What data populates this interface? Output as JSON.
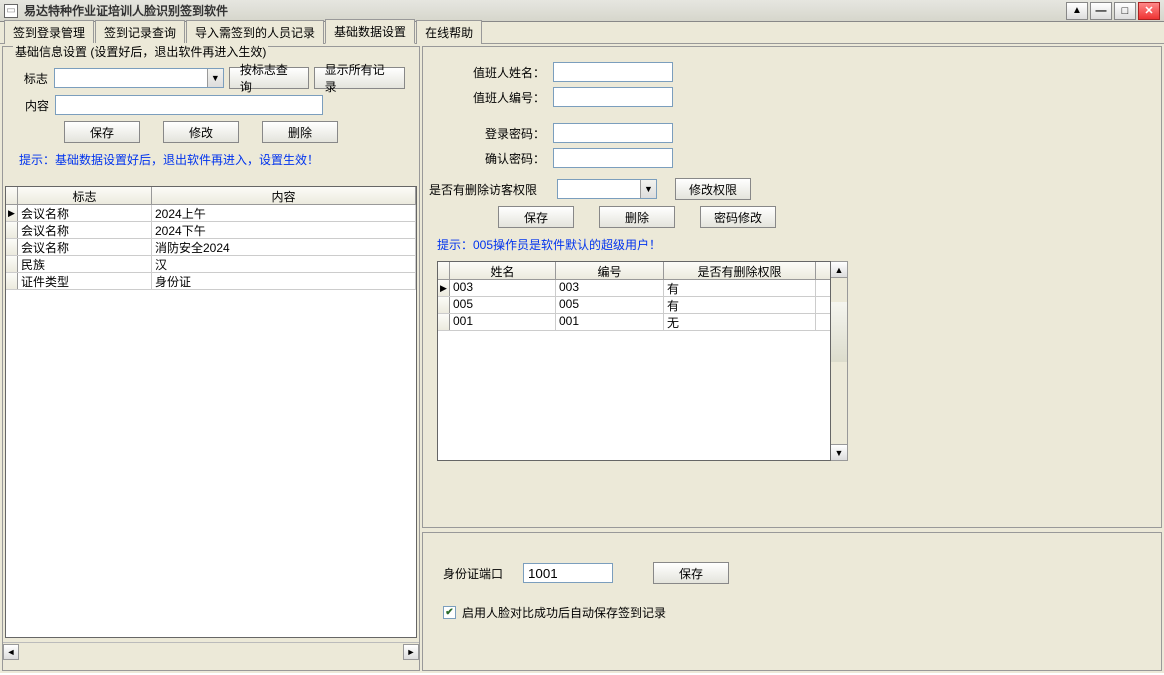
{
  "title": "易达特种作业证培训人脸识别签到软件",
  "tabs": [
    "签到登录管理",
    "签到记录查询",
    "导入需签到的人员记录",
    "基础数据设置",
    "在线帮助"
  ],
  "left": {
    "group_title": "基础信息设置 (设置好后，退出软件再进入生效)",
    "label_mark": "标志",
    "label_content": "内容",
    "btn_search_by_mark": "按标志查询",
    "btn_show_all": "显示所有记录",
    "btn_save": "保存",
    "btn_modify": "修改",
    "btn_delete": "删除",
    "hint": "提示：基础数据设置好后，退出软件再进入，设置生效！",
    "grid_headers": {
      "mark": "标志",
      "content": "内容"
    },
    "grid_rows": [
      {
        "mark": "会议名称",
        "content": "2024上午"
      },
      {
        "mark": "会议名称",
        "content": "2024下午"
      },
      {
        "mark": "会议名称",
        "content": "消防安全2024"
      },
      {
        "mark": "民族",
        "content": "汉"
      },
      {
        "mark": "证件类型",
        "content": "身份证"
      }
    ]
  },
  "right": {
    "label_duty_name": "值班人姓名：",
    "label_duty_id": "值班人编号：",
    "label_password": "登录密码：",
    "label_confirm": "确认密码：",
    "label_has_delete_perm": "是否有删除访客权限",
    "btn_modify_perm": "修改权限",
    "btn_save": "保存",
    "btn_delete": "删除",
    "btn_pwd_modify": "密码修改",
    "hint": "提示：005操作员是软件默认的超级用户！",
    "grid_headers": {
      "name": "姓名",
      "num": "编号",
      "perm": "是否有删除权限"
    },
    "grid_rows": [
      {
        "name": "003",
        "num": "003",
        "perm": "有"
      },
      {
        "name": "005",
        "num": "005",
        "perm": "有"
      },
      {
        "name": "001",
        "num": "001",
        "perm": "无"
      }
    ]
  },
  "bottom": {
    "label_port": "身份证端口",
    "port_value": "1001",
    "btn_save": "保存",
    "checkbox_label": "启用人脸对比成功后自动保存签到记录",
    "checkbox_checked": true
  }
}
